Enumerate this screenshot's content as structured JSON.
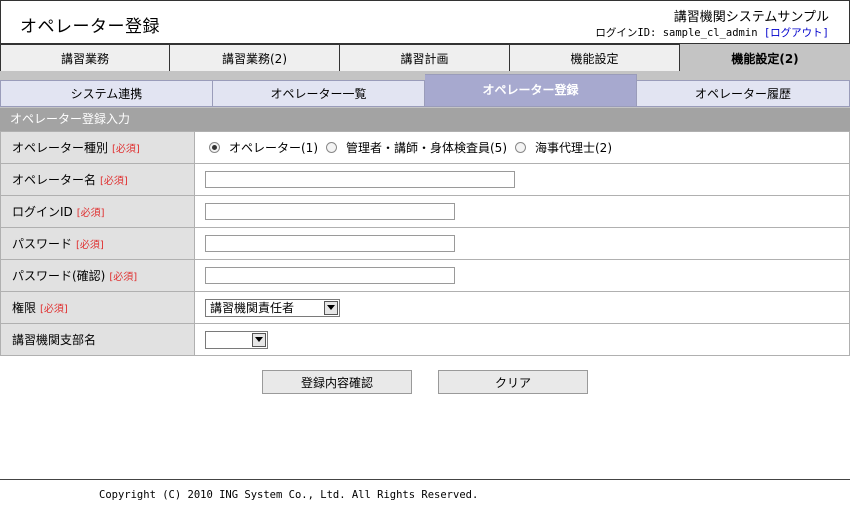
{
  "header": {
    "page_title": "オペレーター登録",
    "system_name": "講習機関システムサンプル",
    "login_prefix": "ログインID: ",
    "login_id": "sample_cl_admin",
    "logout_label": "[ログアウト]"
  },
  "main_tabs": [
    {
      "label": "講習業務"
    },
    {
      "label": "講習業務(2)"
    },
    {
      "label": "講習計画"
    },
    {
      "label": "機能設定"
    },
    {
      "label": "機能設定(2)"
    }
  ],
  "sub_tabs": [
    {
      "label": "システム連携"
    },
    {
      "label": "オペレーター一覧"
    },
    {
      "label": "オペレーター登録"
    },
    {
      "label": "オペレーター履歴"
    }
  ],
  "section_title": "オペレーター登録入力",
  "required_mark": "[必須]",
  "form": {
    "operator_type": {
      "label": "オペレーター種別",
      "options": [
        {
          "label": "オペレーター(1)",
          "checked": true
        },
        {
          "label": "管理者・講師・身体検査員(5)",
          "checked": false
        },
        {
          "label": "海事代理士(2)",
          "checked": false
        }
      ]
    },
    "operator_name": {
      "label": "オペレーター名",
      "value": ""
    },
    "login_id": {
      "label": "ログインID",
      "value": ""
    },
    "password": {
      "label": "パスワード",
      "value": ""
    },
    "password_confirm": {
      "label": "パスワード(確認)",
      "value": ""
    },
    "authority": {
      "label": "権限",
      "selected": "講習機関責任者"
    },
    "branch": {
      "label": "講習機関支部名",
      "selected": ""
    }
  },
  "buttons": {
    "confirm_label": "登録内容確認",
    "clear_label": "クリア"
  },
  "footer": {
    "copyright": "Copyright (C) 2010 ING System Co., Ltd. All Rights Reserved."
  }
}
